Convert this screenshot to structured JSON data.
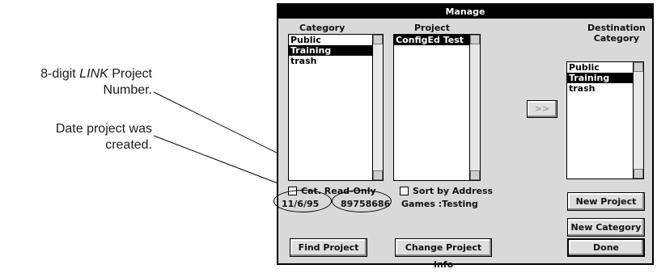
{
  "callouts": {
    "link_number_prefix": "8-digit ",
    "link_number_italic": "LINK",
    "link_number_suffix": " Project",
    "link_number_line2": "Number.",
    "date_line1": "Date project was",
    "date_line2": "created."
  },
  "dialog": {
    "title": "Manage",
    "category_label": "Category",
    "project_label": "Project",
    "destination_label_line1": "Destination",
    "destination_label_line2": "Category",
    "category_items": [
      "Public",
      "Training",
      "trash"
    ],
    "category_selected": "Training",
    "project_items": [
      "ConfigEd Test"
    ],
    "destination_items": [
      "Public",
      "Training",
      "trash"
    ],
    "destination_selected": "Training",
    "move_button": ">>",
    "cat_read_only_label": "Cat. Read-Only",
    "sort_by_address_label": "Sort by Address",
    "date_value": "11/6/95",
    "link_number_value": "89758686",
    "project_info": "Games :Testing",
    "new_project_button": "New Project",
    "new_category_button": "New Category",
    "find_project_button": "Find Project",
    "change_project_info_button": "Change Project Info",
    "done_button": "Done"
  }
}
